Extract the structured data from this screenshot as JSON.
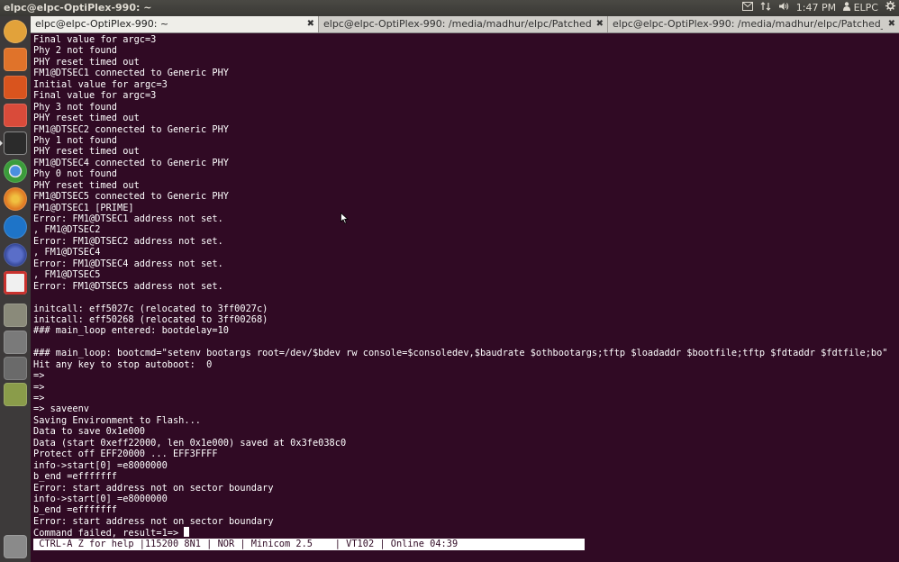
{
  "panel": {
    "title": "elpc@elpc-OptiPlex-990: ~",
    "clock": "1:47 PM",
    "user": "ELPC"
  },
  "tabs": [
    {
      "label": "elpc@elpc-OptiPlex-990: ~",
      "active": true
    },
    {
      "label": "elpc@elpc-OptiPlex-990: /media/madhur/elpc/Patched_u-bo...",
      "active": false
    },
    {
      "label": "elpc@elpc-OptiPlex-990: /media/madhur/elpc/Patched_u-bo...",
      "active": false
    }
  ],
  "launcher": [
    {
      "name": "dash-home-icon",
      "color": "#e2a23a"
    },
    {
      "name": "files-icon",
      "color": "#e0732a"
    },
    {
      "name": "software-center-icon",
      "color": "#d9541e"
    },
    {
      "name": "system-settings-icon",
      "color": "#d94b3a"
    },
    {
      "name": "terminal-icon",
      "color": "#2b2b2b"
    },
    {
      "name": "chrome-icon",
      "color": "#3b9c3a"
    },
    {
      "name": "firefox-icon",
      "color": "#e07a24"
    },
    {
      "name": "teamviewer-icon",
      "color": "#1e74c8"
    },
    {
      "name": "eclipse-icon",
      "color": "#2c3e8c"
    },
    {
      "name": "document-viewer-icon",
      "color": "#c8322e"
    },
    {
      "name": "calculator-icon",
      "color": "#8a8a7a"
    },
    {
      "name": "help-icon",
      "color": "#7a7a7a"
    },
    {
      "name": "workspace-switcher-icon",
      "color": "#6a6a6a"
    },
    {
      "name": "usb-drive-icon",
      "color": "#8a9c4a"
    },
    {
      "name": "trash-icon",
      "color": "#8a8a8a"
    }
  ],
  "terminal": {
    "lines": [
      "Final value for argc=3",
      "Phy 2 not found",
      "PHY reset timed out",
      "FM1@DTSEC1 connected to Generic PHY",
      "Initial value for argc=3",
      "Final value for argc=3",
      "Phy 3 not found",
      "PHY reset timed out",
      "FM1@DTSEC2 connected to Generic PHY",
      "Phy 1 not found",
      "PHY reset timed out",
      "FM1@DTSEC4 connected to Generic PHY",
      "Phy 0 not found",
      "PHY reset timed out",
      "FM1@DTSEC5 connected to Generic PHY",
      "FM1@DTSEC1 [PRIME]",
      "Error: FM1@DTSEC1 address not set.",
      ", FM1@DTSEC2",
      "Error: FM1@DTSEC2 address not set.",
      ", FM1@DTSEC4",
      "Error: FM1@DTSEC4 address not set.",
      ", FM1@DTSEC5",
      "Error: FM1@DTSEC5 address not set.",
      "",
      "initcall: eff5027c (relocated to 3ff0027c)",
      "initcall: eff50268 (relocated to 3ff00268)",
      "### main_loop entered: bootdelay=10",
      "",
      "### main_loop: bootcmd=\"setenv bootargs root=/dev/$bdev rw console=$consoledev,$baudrate $othbootargs;tftp $loadaddr $bootfile;tftp $fdtaddr $fdtfile;bo\"",
      "Hit any key to stop autoboot:  0",
      "=>",
      "=>",
      "=>",
      "=> saveenv",
      "Saving Environment to Flash...",
      "Data to save 0x1e000",
      "Data (start 0xeff22000, len 0x1e000) saved at 0x3fe038c0",
      "Protect off EFF20000 ... EFF3FFFF",
      "info->start[0] =e8000000",
      "b_end =efffffff",
      "Error: start address not on sector boundary",
      "info->start[0] =e8000000",
      "b_end =efffffff",
      "Error: start address not on sector boundary"
    ],
    "prompt_line": "Command failed, result=1=> ",
    "status_bar": " CTRL-A Z for help |115200 8N1 | NOR | Minicom 2.5    | VT102 | Online 04:39"
  }
}
